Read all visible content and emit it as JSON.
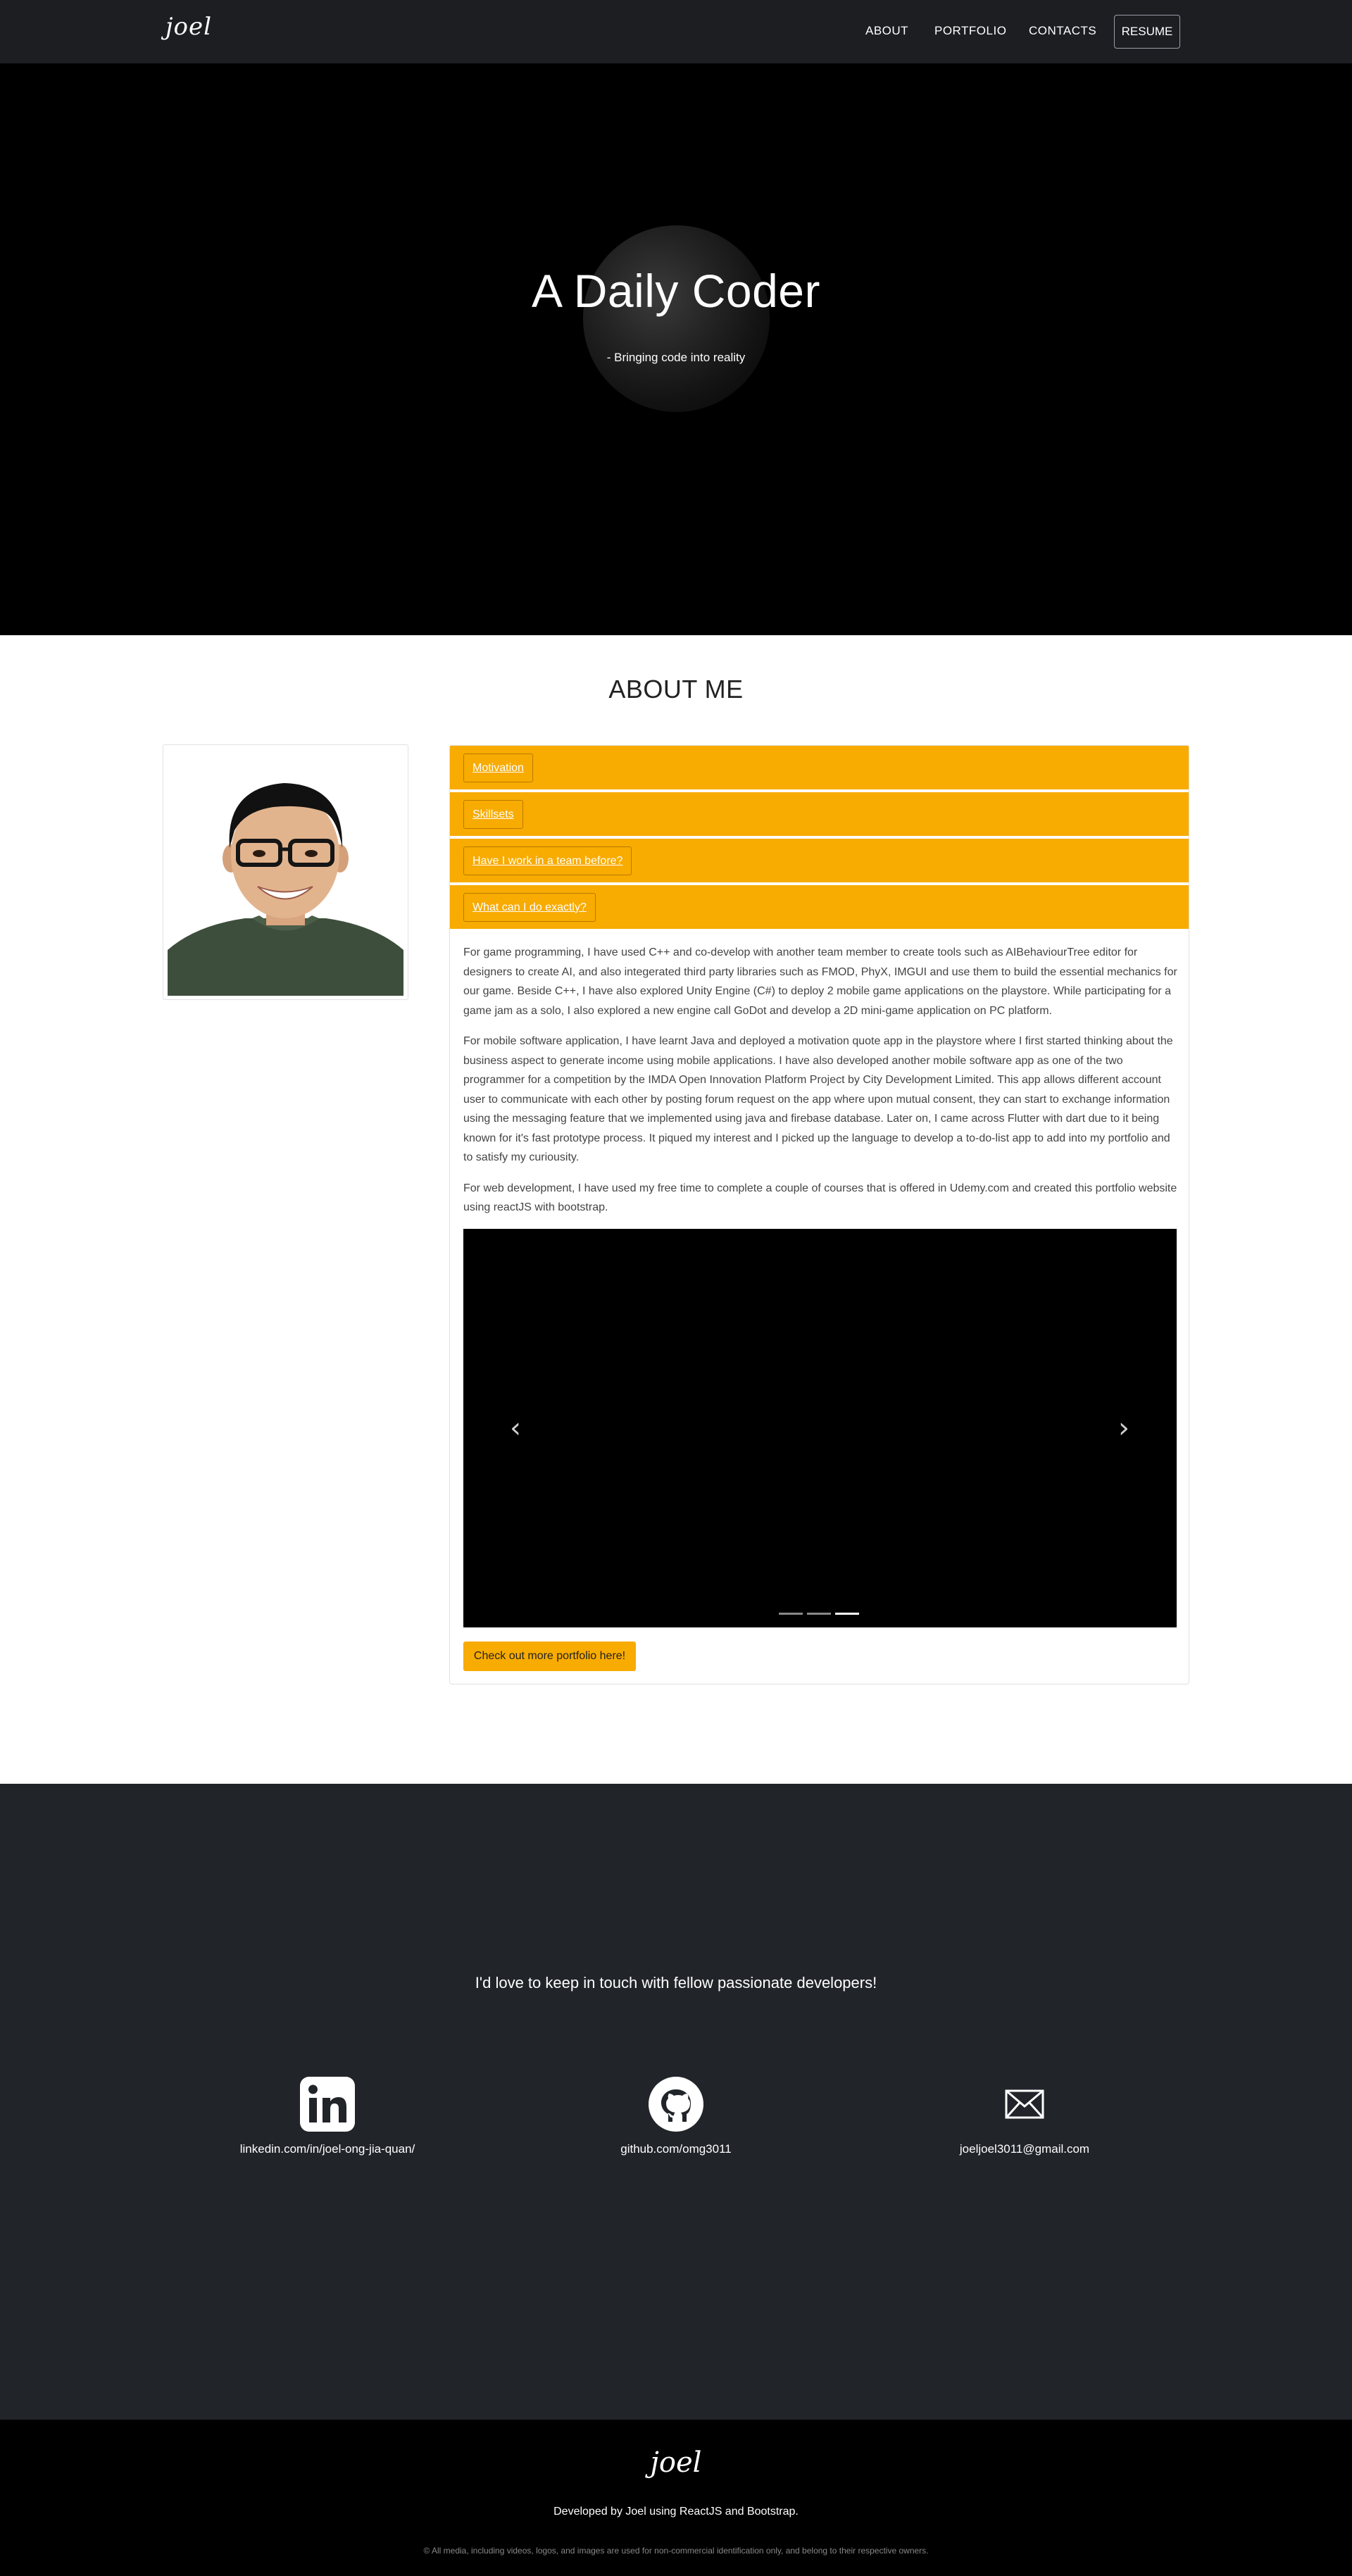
{
  "nav": {
    "brand": "joel",
    "about": "ABOUT",
    "portfolio": "PORTFOLIO",
    "contacts": "CONTACTS",
    "resume": "RESUME"
  },
  "hero": {
    "title": "A Daily Coder",
    "subtitle": "- Bringing code into reality"
  },
  "about": {
    "title": "ABOUT ME",
    "sections": [
      {
        "label": "Motivation"
      },
      {
        "label": "Skillsets"
      },
      {
        "label": "Have I work in a team before?"
      },
      {
        "label": "What can I do exactly?"
      }
    ],
    "expanded_section": 3,
    "paragraphs": [
      "For game programming, I have used C++ and co-develop with another team member to create tools such as AIBehaviourTree editor for designers to create AI, and also integerated third party libraries such as FMOD, PhyX, IMGUI and use them to build the essential mechanics for our game. Beside C++, I have also explored Unity Engine (C#) to deploy 2 mobile game applications on the playstore. While participating for a game jam as a solo, I also explored a new engine call GoDot and develop a 2D mini-game application on PC platform.",
      "For mobile software application, I have learnt Java and deployed a motivation quote app in the playstore where I first started thinking about the business aspect to generate income using mobile applications. I have also developed another mobile software app as one of the two programmer for a competition by the IMDA Open Innovation Platform Project by City Development Limited. This app allows different account user to communicate with each other by posting forum request on the app where upon mutual consent, they can start to exchange information using the messaging feature that we implemented using java and firebase database. Later on, I came across Flutter with dart due to it being known for it's fast prototype process. It piqued my interest and I picked up the language to develop a to-do-list app to add into my portfolio and to satisfy my curiousity.",
      "For web development, I have used my free time to complete a couple of courses that is offered in Udemy.com and created this portfolio website using reactJS with bootstrap."
    ],
    "carousel": {
      "prev_icon": "chevron-left-icon",
      "next_icon": "chevron-right-icon",
      "slide_count": 3,
      "active_slide": 3
    },
    "more_button": "Check out more portfolio here!"
  },
  "contact": {
    "title": "I'd love to keep in touch with fellow passionate developers!",
    "items": [
      {
        "icon": "linkedin-icon",
        "label": "linkedin.com/in/joel-ong-jia-quan/"
      },
      {
        "icon": "github-icon",
        "label": "github.com/omg3011"
      },
      {
        "icon": "mail-icon",
        "label": "joeljoel3011@gmail.com"
      }
    ]
  },
  "footer": {
    "logo": "joel",
    "developed_by": "Developed by Joel using ReactJS and Bootstrap.",
    "copyright": "© All media, including videos, logos, and images are used for non-commercial identification only, and belong to their respective owners."
  },
  "colors": {
    "accent": "#f8ab00",
    "navbar": "#1c1e22",
    "contact_bg": "#212429",
    "hero_bg": "#000000"
  }
}
